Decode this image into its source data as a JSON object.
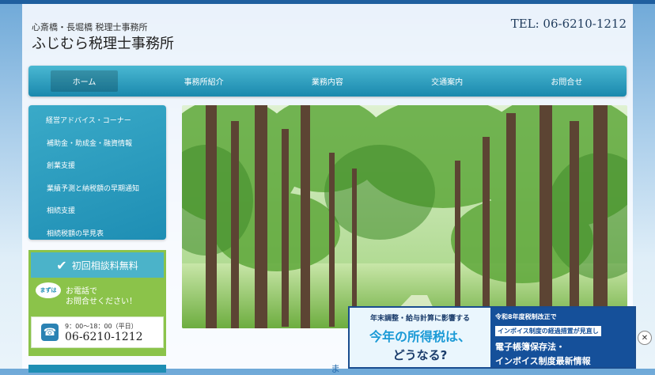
{
  "header": {
    "kicker": "心斎橋・長堀橋 税理士事務所",
    "title": "ふじむら税理士事務所",
    "tel": "TEL: 06-6210-1212"
  },
  "nav": {
    "items": [
      {
        "label": "ホーム",
        "active": true
      },
      {
        "label": "事務所紹介",
        "active": false
      },
      {
        "label": "業務内容",
        "active": false
      },
      {
        "label": "交通案内",
        "active": false
      },
      {
        "label": "お問合せ",
        "active": false
      }
    ]
  },
  "sidebar": {
    "items": [
      {
        "label": "経営アドバイス・コーナー"
      },
      {
        "label": "補助金・助成金・融資情報"
      },
      {
        "label": "創業支援"
      },
      {
        "label": "業績予測と納税額の早期通知"
      },
      {
        "label": "相続支援"
      },
      {
        "label": "相続税額の早見表"
      }
    ]
  },
  "consult": {
    "title": "初回相談料無料",
    "bubble": "まずは",
    "call_line1": "お電話で",
    "call_line2": "お問合せください！",
    "hours": "9：00～18：00（平日）",
    "phone": "06-6210-1212"
  },
  "main": {
    "under_text": "ま"
  },
  "ad": {
    "left_line1": "年末調整・給与計算に影響する",
    "left_line2": "今年の所得税は、",
    "left_line3": "どうなる?",
    "right_line1": "令和8年度税制改正で",
    "right_line2": "インボイス制度の経過措置が見直し",
    "right_line3": "電子帳簿保存法・",
    "right_line4": "インボイス制度最新情報",
    "close": "✕"
  }
}
